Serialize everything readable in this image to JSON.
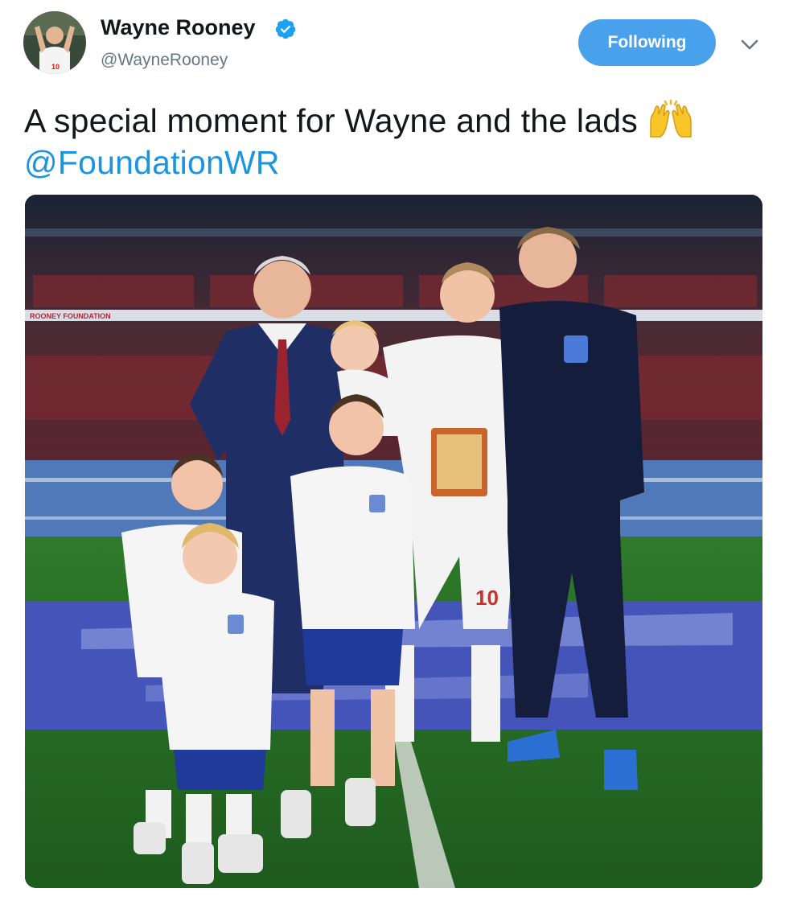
{
  "tweet": {
    "author": {
      "name": "Wayne Rooney",
      "handle": "@WayneRooney",
      "verified": true,
      "avatar_icon": "profile-photo"
    },
    "follow_button_label": "Following",
    "menu_icon": "chevron-down-icon",
    "text": "A special moment for Wayne and the lads",
    "emoji": "raised-hands-emoji",
    "mention": "@FoundationWR",
    "media": {
      "description_icon": "photo",
      "banner_text": "ROONEY FOUNDATION",
      "shirt_number": "10"
    }
  },
  "colors": {
    "accent": "#1b95e0",
    "follow_button": "#4aa1eb",
    "secondary_text": "#657786",
    "primary_text": "#14171a"
  }
}
